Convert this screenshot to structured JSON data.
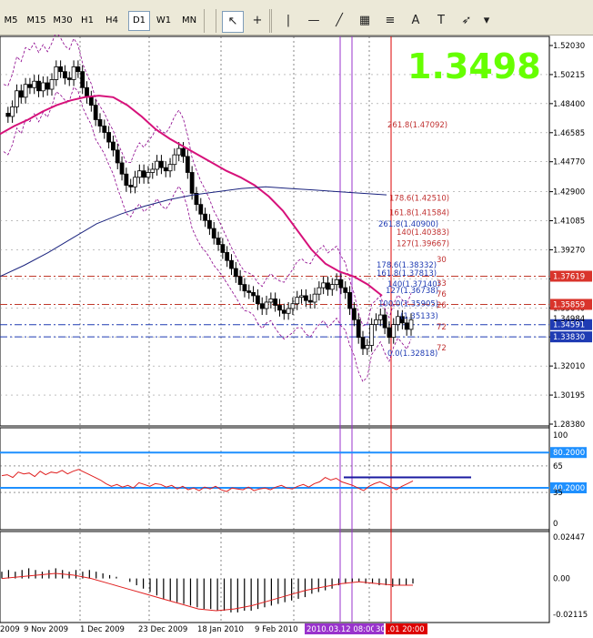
{
  "toolbar": {
    "timeframes": [
      "M5",
      "M15",
      "M30",
      "H1",
      "H4",
      "D1",
      "W1",
      "MN"
    ],
    "active_timeframe": "D1",
    "tools": [
      {
        "name": "cursor-tool",
        "glyph": "↖"
      },
      {
        "name": "crosshair-tool",
        "glyph": "+"
      },
      {
        "name": "vertical-line-tool",
        "glyph": "|"
      },
      {
        "name": "horizontal-line-tool",
        "glyph": "—"
      },
      {
        "name": "trendline-tool",
        "glyph": "╱"
      },
      {
        "name": "equidistant-channel-tool",
        "glyph": "▦"
      },
      {
        "name": "fibonacci-retracement-tool",
        "glyph": "≡"
      },
      {
        "name": "text-tool",
        "glyph": "A"
      },
      {
        "name": "text-label-tool",
        "glyph": "T"
      },
      {
        "name": "arrows-tool",
        "glyph": "➶"
      },
      {
        "name": "dropdown-tool",
        "glyph": "▾"
      }
    ]
  },
  "chart_data": {
    "type": "candlestick",
    "big_price": "1.3498",
    "main_axis_ticks": [
      "1.52030",
      "1.50215",
      "1.48400",
      "1.46585",
      "1.44770",
      "1.42900",
      "1.41085",
      "1.39270",
      "1.37455",
      "1.35640",
      "1.33825",
      "1.32010",
      "1.30195",
      "1.28380"
    ],
    "ylim": [
      1.2838,
      1.5203
    ],
    "price_labels": [
      {
        "text": "1.37619",
        "value": 1.37619,
        "color": "#d9342b"
      },
      {
        "text": "1.35859",
        "value": 1.35859,
        "color": "#d9342b"
      },
      {
        "text": "1.34591",
        "value": 1.34591,
        "color": "#1f3bb3"
      },
      {
        "text": "1.33830",
        "value": 1.3383,
        "color": "#1f3bb3"
      }
    ],
    "current_price_label": "1.34984",
    "fib_labels": [
      {
        "text": "261.8(1.47092)",
        "color": "#c03030",
        "value": 1.47092
      },
      {
        "text": "178.6(1.42510)",
        "color": "#c03030",
        "value": 1.4251
      },
      {
        "text": "161.8(1.41584)",
        "color": "#c03030",
        "value": 1.41584
      },
      {
        "text": "261.8(1.40900)",
        "color": "#1f3bb3",
        "value": 1.409
      },
      {
        "text": "140(1.40383)",
        "color": "#c03030",
        "value": 1.40383
      },
      {
        "text": "127(1.39667)",
        "color": "#c03030",
        "value": 1.39667
      },
      {
        "text": "178.6(1.38332)",
        "color": "#1f3bb3",
        "value": 1.38332
      },
      {
        "text": "161.8(1.37813)",
        "color": "#1f3bb3",
        "value": 1.37813
      },
      {
        "text": "140(1.37140)",
        "color": "#1f3bb3",
        "value": 1.3714
      },
      {
        "text": "127(1.36738)",
        "color": "#1f3bb3",
        "value": 1.36738
      },
      {
        "text": "100.0(1.35905)",
        "color": "#1f3bb3",
        "value": 1.35905
      },
      {
        "text": "(1.35133)",
        "color": "#1f3bb3",
        "value": 1.35133
      },
      {
        "text": "0.0(1.32818)",
        "color": "#1f3bb3",
        "value": 1.32818
      }
    ],
    "fib_fragments": [
      "30",
      "33",
      "76",
      "26",
      "72",
      "72"
    ],
    "h_lines": [
      {
        "value": 1.37619,
        "color": "#c0392b",
        "style": "dashdot"
      },
      {
        "value": 1.35859,
        "color": "#c0392b",
        "style": "dashdot"
      },
      {
        "value": 1.34591,
        "color": "#1f3bb3",
        "style": "dashdot"
      },
      {
        "value": 1.3383,
        "color": "#1f3bb3",
        "style": "dashdot"
      }
    ],
    "x_labels": [
      "2009",
      "9 Nov 2009",
      "1 Dec 2009",
      "23 Dec 2009",
      "18 Jan 2010",
      "9 Feb 2010"
    ],
    "x_highlight_labels": [
      {
        "text": "2010.03.12 08:00",
        "bg": "#9933cc"
      },
      {
        "text": "30",
        "bg": "#9933cc"
      },
      {
        "text": ".01 20:00",
        "bg": "#dd0000"
      }
    ],
    "series": [
      {
        "name": "closes",
        "values": [
          1.478,
          1.476,
          1.482,
          1.492,
          1.488,
          1.496,
          1.494,
          1.498,
          1.492,
          1.497,
          1.493,
          1.499,
          1.507,
          1.504,
          1.5,
          1.499,
          1.507,
          1.504,
          1.494,
          1.488,
          1.483,
          1.474,
          1.47,
          1.466,
          1.46,
          1.455,
          1.447,
          1.44,
          1.433,
          1.432,
          1.438,
          1.442,
          1.438,
          1.441,
          1.443,
          1.448,
          1.444,
          1.442,
          1.446,
          1.452,
          1.456,
          1.451,
          1.441,
          1.428,
          1.421,
          1.415,
          1.411,
          1.406,
          1.4,
          1.396,
          1.391,
          1.386,
          1.381,
          1.376,
          1.371,
          1.367,
          1.366,
          1.364,
          1.359,
          1.356,
          1.36,
          1.362,
          1.358,
          1.355,
          1.353,
          1.356,
          1.359,
          1.363,
          1.364,
          1.361,
          1.36,
          1.365,
          1.369,
          1.372,
          1.368,
          1.371,
          1.374,
          1.369,
          1.366,
          1.356,
          1.349,
          1.338,
          1.331,
          1.333,
          1.346,
          1.349,
          1.352,
          1.344,
          1.338,
          1.346,
          1.351,
          1.347,
          1.343,
          1.349
        ]
      },
      {
        "name": "ma_magenta",
        "values": [
          1.465,
          1.47,
          1.474,
          1.479,
          1.483,
          1.486,
          1.488,
          1.489,
          1.488,
          1.483,
          1.476,
          1.468,
          1.462,
          1.457,
          1.452,
          1.447,
          1.442,
          1.438,
          1.433,
          1.426,
          1.417,
          1.405,
          1.393,
          1.384,
          1.379,
          1.376,
          1.371,
          1.364
        ]
      },
      {
        "name": "ma_navy",
        "values": [
          1.376,
          1.383,
          1.391,
          1.4,
          1.409,
          1.415,
          1.42,
          1.424,
          1.427,
          1.429,
          1.431,
          1.432,
          1.431,
          1.43,
          1.429,
          1.428,
          1.427
        ]
      }
    ],
    "rsi": {
      "ticks": [
        "100",
        "80.2000",
        "65",
        "40.2000",
        "35",
        "0"
      ],
      "upper_level": "80.2000",
      "lower_level": "40.2000",
      "values": [
        54,
        55,
        52,
        58,
        56,
        57,
        53,
        59,
        55,
        58,
        57,
        60,
        56,
        59,
        61,
        58,
        55,
        52,
        49,
        45,
        42,
        44,
        41,
        43,
        40,
        46,
        44,
        42,
        45,
        44,
        41,
        43,
        39,
        42,
        38,
        40,
        37,
        41,
        39,
        42,
        38,
        36,
        40,
        39,
        38,
        41,
        37,
        39,
        40,
        38,
        41,
        43,
        40,
        39,
        42,
        44,
        41,
        45,
        47,
        52,
        49,
        51,
        47,
        45,
        43,
        40,
        37,
        42,
        45,
        47,
        44,
        41,
        38,
        42,
        45,
        48
      ]
    },
    "macd": {
      "ticks": [
        "0.02447",
        "0.00",
        "-0.02115"
      ],
      "histogram": [
        0.004,
        0.005,
        0.004,
        0.005,
        0.006,
        0.005,
        0.004,
        0.005,
        0.006,
        0.005,
        0.004,
        0.005,
        0.004,
        0.005,
        0.004,
        0.003,
        0.002,
        0.001,
        0.0,
        -0.002,
        -0.004,
        -0.006,
        -0.008,
        -0.01,
        -0.012,
        -0.013,
        -0.014,
        -0.015,
        -0.016,
        -0.017,
        -0.018,
        -0.018,
        -0.019,
        -0.019,
        -0.02,
        -0.02,
        -0.019,
        -0.019,
        -0.018,
        -0.017,
        -0.016,
        -0.015,
        -0.014,
        -0.013,
        -0.012,
        -0.011,
        -0.009,
        -0.008,
        -0.007,
        -0.006,
        -0.004,
        -0.003,
        -0.002,
        -0.002,
        -0.003,
        -0.003,
        -0.004,
        -0.004,
        -0.005,
        -0.004,
        -0.004,
        -0.003
      ],
      "signal": [
        0.0,
        0.001,
        0.002,
        0.003,
        0.002,
        0.0,
        -0.003,
        -0.006,
        -0.009,
        -0.012,
        -0.015,
        -0.018,
        -0.019,
        -0.018,
        -0.016,
        -0.013,
        -0.01,
        -0.007,
        -0.005,
        -0.003,
        -0.002,
        -0.003,
        -0.004,
        -0.004
      ]
    }
  }
}
